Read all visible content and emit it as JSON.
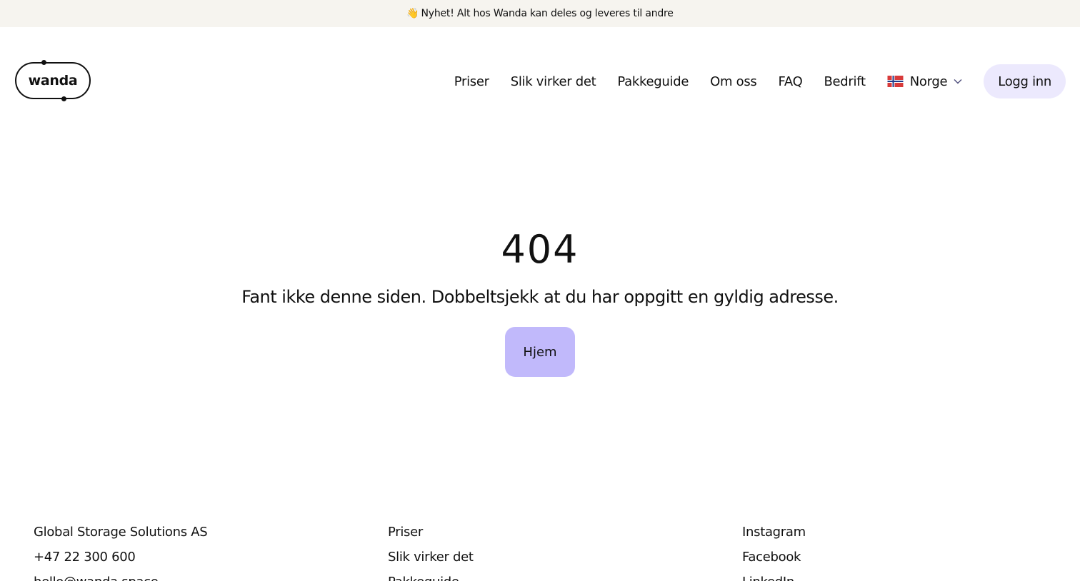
{
  "announcement": {
    "emoji": "👋",
    "text": "Nyhet! Alt hos Wanda kan deles og leveres til andre"
  },
  "header": {
    "logo_text": "wanda",
    "nav": [
      "Priser",
      "Slik virker det",
      "Pakkeguide",
      "Om oss",
      "FAQ",
      "Bedrift"
    ],
    "country": {
      "label": "Norge",
      "flag_icon": "norway-flag-icon",
      "flag_colors": {
        "red": "#d83a3a",
        "white": "#ffffff",
        "blue": "#1f3b8a"
      }
    },
    "login_label": "Logg inn"
  },
  "main": {
    "error_code": "404",
    "message": "Fant ikke denne siden. Dobbeltsjekk at du har oppgitt en gyldig adresse.",
    "home_button": "Hjem"
  },
  "footer": {
    "company": [
      "Global Storage Solutions AS",
      "+47 22 300 600",
      "hello@wanda.space"
    ],
    "links": [
      "Priser",
      "Slik virker det",
      "Pakkeguide"
    ],
    "social": [
      "Instagram",
      "Facebook",
      "LinkedIn"
    ]
  },
  "colors": {
    "announcement_bg": "#f6f4ef",
    "login_bg": "#ece9fd",
    "home_button_bg": "#c1b9fb",
    "text": "#111111"
  }
}
